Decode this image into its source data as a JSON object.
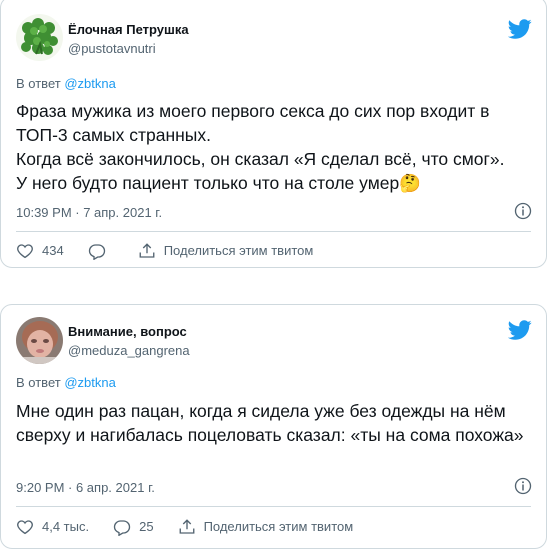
{
  "tweets": [
    {
      "author_name": "Ёлочная Петрушка",
      "author_handle": "@pustotavnutri",
      "reply_prefix": "В ответ ",
      "reply_to": "@zbtkna",
      "text": "Фраза мужика из моего первого секса до сих пор входит в ТОП-3 самых странных.\nКогда всё закончилось, он сказал «Я сделал всё, что смог».\nУ него будто пациент только что на столе умер",
      "emoji": "🤔",
      "timestamp": "10:39 PM · 7 апр. 2021 г.",
      "likes": "434",
      "replies": "",
      "share_label": "Поделиться этим твитом"
    },
    {
      "author_name": "Внимание, вопрос",
      "author_handle": "@meduza_gangrena",
      "reply_prefix": "В ответ ",
      "reply_to": "@zbtkna",
      "text": "Мне один раз пацан, когда я сидела уже без одежды на нём сверху и нагибалась поцеловать сказал: «ты на сома похожа»",
      "emoji": "",
      "timestamp": "9:20 PM · 6 апр. 2021 г.",
      "likes": "4,4 тыс.",
      "replies": "25",
      "share_label": "Поделиться этим твитом"
    }
  ],
  "colors": {
    "brand": "#1d9bf0",
    "secondary_text": "#536471",
    "border": "#cfd9de"
  },
  "icons": [
    "twitter-bird-icon",
    "info-icon",
    "heart-icon",
    "reply-icon",
    "share-icon"
  ]
}
